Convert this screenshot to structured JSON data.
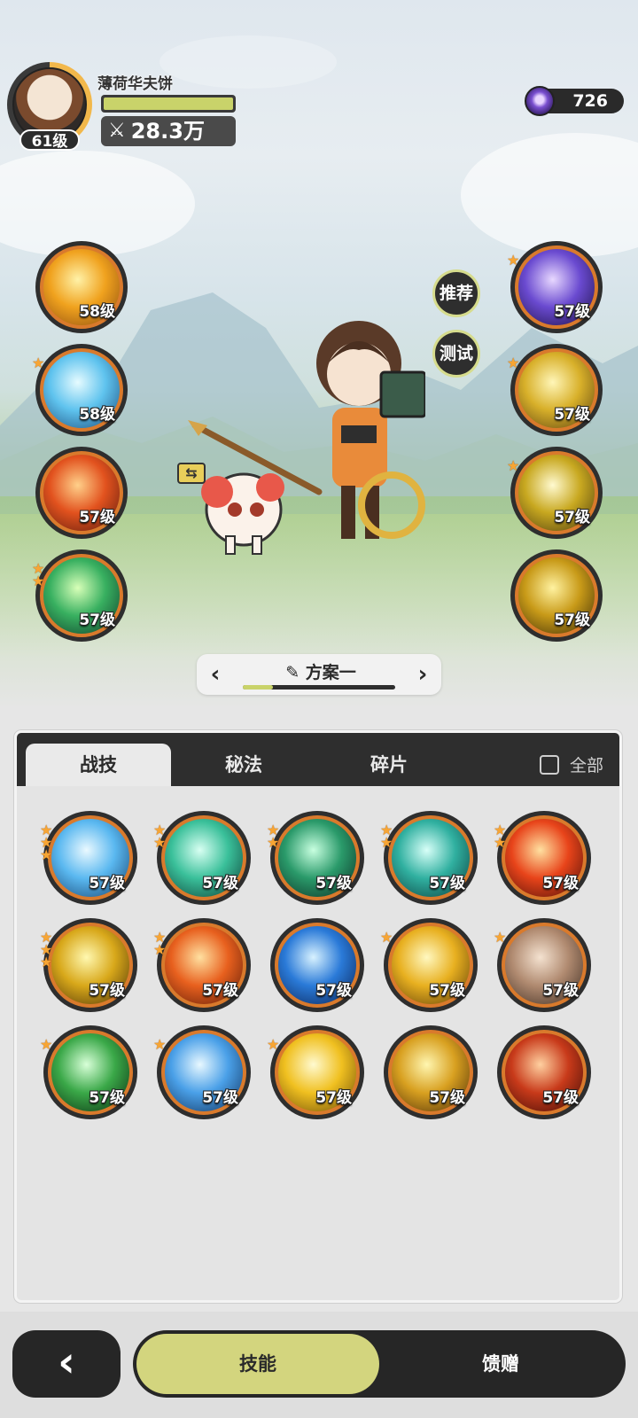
{
  "player": {
    "name": "薄荷华夫饼",
    "level": "61级",
    "power": "28.3万",
    "xp_fraction": 1.0
  },
  "currency": {
    "amount": "726",
    "icon": "purple-gem-icon"
  },
  "side_buttons": {
    "recommend": "推荐",
    "test": "测试"
  },
  "equipped_left": [
    {
      "level": "58级",
      "stars": 0,
      "icon": "golden-slash-icon"
    },
    {
      "level": "58级",
      "stars": 1,
      "icon": "ice-crystal-icon"
    },
    {
      "level": "57级",
      "stars": 0,
      "icon": "fire-vortex-icon"
    },
    {
      "level": "57级",
      "stars": 2,
      "icon": "green-wind-icon"
    }
  ],
  "equipped_right": [
    {
      "level": "57级",
      "stars": 1,
      "icon": "starry-portal-icon"
    },
    {
      "level": "57级",
      "stars": 1,
      "icon": "gold-burst-icon"
    },
    {
      "level": "57级",
      "stars": 1,
      "icon": "holy-arrow-icon"
    },
    {
      "level": "57级",
      "stars": 0,
      "icon": "golden-guardian-icon"
    }
  ],
  "plan": {
    "title": "方案一",
    "progress": 0.2
  },
  "tabs": [
    {
      "label": "战技",
      "active": true
    },
    {
      "label": "秘法",
      "active": false
    },
    {
      "label": "碎片",
      "active": false
    }
  ],
  "filter_all": "全部",
  "skills_grid": [
    {
      "level": "57级",
      "stars": 3,
      "icon": "ice-shatter-icon"
    },
    {
      "level": "57级",
      "stars": 2,
      "icon": "green-blades-icon"
    },
    {
      "level": "57级",
      "stars": 2,
      "icon": "thorn-vine-icon"
    },
    {
      "level": "57级",
      "stars": 2,
      "icon": "cyclone-icon"
    },
    {
      "level": "57级",
      "stars": 2,
      "icon": "fireball-icon"
    },
    {
      "level": "57级",
      "stars": 3,
      "icon": "golden-crystal-icon"
    },
    {
      "level": "57级",
      "stars": 2,
      "icon": "flame-orb-icon"
    },
    {
      "level": "57级",
      "stars": 0,
      "icon": "water-wave-icon"
    },
    {
      "level": "57级",
      "stars": 1,
      "icon": "lightning-strike-icon"
    },
    {
      "level": "57级",
      "stars": 1,
      "icon": "rock-cards-icon"
    },
    {
      "level": "57级",
      "stars": 1,
      "icon": "healing-cross-icon"
    },
    {
      "level": "57级",
      "stars": 1,
      "icon": "ice-shard-icon"
    },
    {
      "level": "57级",
      "stars": 1,
      "icon": "sun-rise-icon"
    },
    {
      "level": "57级",
      "stars": 0,
      "icon": "thunder-chain-icon"
    },
    {
      "level": "57级",
      "stars": 0,
      "icon": "fire-spiral-icon"
    }
  ],
  "bottom_nav": {
    "back": "‹",
    "skills": "技能",
    "gift": "馈赠"
  },
  "colors": {
    "accent": "#d3d57e",
    "dark": "#262626",
    "skill_ring": "#d97a2c",
    "star": "#f7a534"
  }
}
